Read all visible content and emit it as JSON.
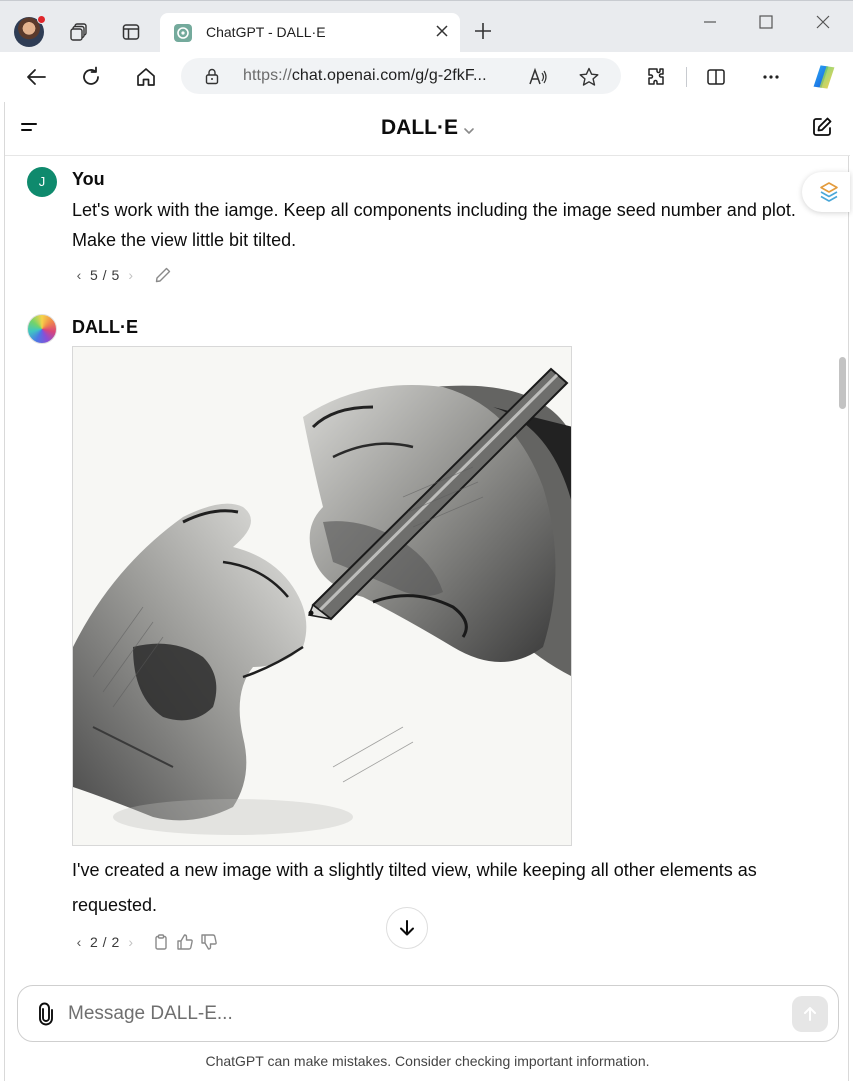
{
  "browser": {
    "tab_title": "ChatGPT - DALL·E",
    "url_scheme": "https://",
    "url_host": "chat.openai.com/g/g-2fkF...",
    "read_aloud_label": "A⁾"
  },
  "header": {
    "title": "DALL·E"
  },
  "conversation": {
    "user": {
      "avatar_letter": "J",
      "author": "You",
      "text": "Let's work with the iamge. Keep all components including the image seed number and plot. Make the view little bit tilted.",
      "version": "5 / 5"
    },
    "assistant": {
      "author": "DALL·E",
      "text": "I've created a new image with a slightly tilted view, while keeping all other elements as requested.",
      "version": "2 / 2"
    }
  },
  "composer": {
    "placeholder": "Message DALL-E..."
  },
  "footer": {
    "disclaimer": "ChatGPT can make mistakes. Consider checking important information."
  },
  "colors": {
    "user_avatar": "#0f8a6d",
    "chrome_bg": "#e9ebee",
    "send_disabled": "#e6e6e6"
  },
  "icons": [
    "profile-avatar-icon",
    "workspaces-icon",
    "tab-actions-icon",
    "chatgpt-favicon-icon",
    "close-icon",
    "plus-icon",
    "minimize-icon",
    "maximize-icon",
    "back-arrow-icon",
    "refresh-icon",
    "home-icon",
    "lock-icon",
    "read-aloud-icon",
    "favorite-star-icon",
    "extensions-icon",
    "split-screen-icon",
    "more-icon",
    "copilot-icon",
    "menu-icon",
    "chevron-down-icon",
    "new-chat-icon",
    "pencil-edit-icon",
    "copy-icon",
    "thumbs-up-icon",
    "thumbs-down-icon",
    "arrow-down-icon",
    "paperclip-icon",
    "arrow-up-icon"
  ]
}
